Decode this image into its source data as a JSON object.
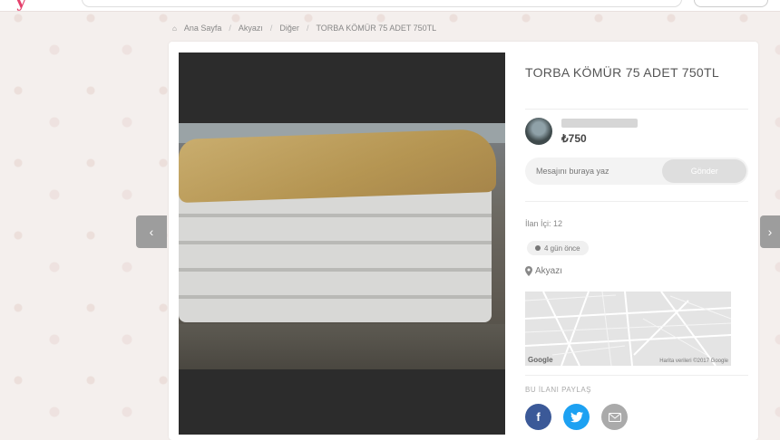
{
  "header": {
    "logo": "y"
  },
  "breadcrumb": [
    "Ana Sayfa",
    "Akyazı",
    "Diğer",
    "TORBA KÖMÜR 75 ADET 750TL"
  ],
  "listing": {
    "title": "TORBA KÖMÜR 75 ADET 750TL",
    "price": "750",
    "currency_glyph": "₺",
    "message_placeholder": "Mesajını buraya yaz",
    "send_label": "Gönder",
    "item_label": "İlan İçi: 12",
    "time_ago": "4 gün önce",
    "location": "Akyazı",
    "map_brand": "Google",
    "map_credit": "Harita verileri ©2017 Google",
    "share_label": "BU İLANI PAYLAŞ"
  },
  "nav": {
    "prev": "‹",
    "next": "›"
  },
  "colors": {
    "brand": "#e4406b",
    "facebook": "#3b5998",
    "twitter": "#1da1f2",
    "email": "#aaaaaa"
  },
  "icons": [
    "home-icon",
    "location-pin-icon",
    "facebook-icon",
    "twitter-icon",
    "email-icon",
    "clock-dot-icon"
  ]
}
